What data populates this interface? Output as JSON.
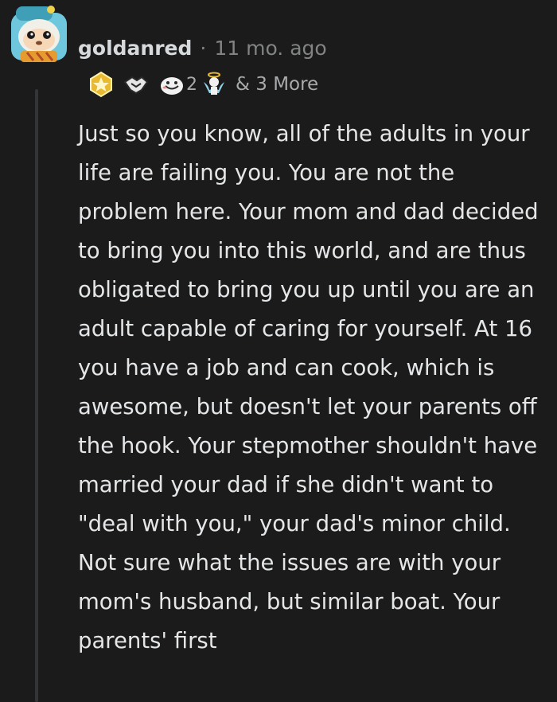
{
  "comment": {
    "author": "goldanred",
    "separator": "·",
    "timestamp": "11 mo. ago",
    "awards": [
      {
        "icon": "gold-award-icon"
      },
      {
        "icon": "handshake-award-icon"
      },
      {
        "icon": "wholesome-award-icon",
        "count": "2"
      },
      {
        "icon": "angel-award-icon"
      }
    ],
    "more_awards_label": "& 3 More",
    "body": "Just so you know, all of the adults in your life are failing you. You are not the problem here. Your mom and dad decided to bring you into this world, and are thus obligated to bring you up until you are an adult capable of caring for yourself. At 16 you have a job and can cook, which is awesome, but doesn't let your parents off the hook. Your stepmother shouldn't have married your dad if she didn't want to \"deal with you,\" your dad's minor child. Not sure what the issues are with your mom's husband, but similar boat. Your parents' first"
  },
  "colors": {
    "background": "#1b1b1b",
    "username": "#d7dadc",
    "meta": "#818384",
    "body_text": "#e4e6e8",
    "thread_line": "#343536",
    "gold": "#e8b931"
  }
}
